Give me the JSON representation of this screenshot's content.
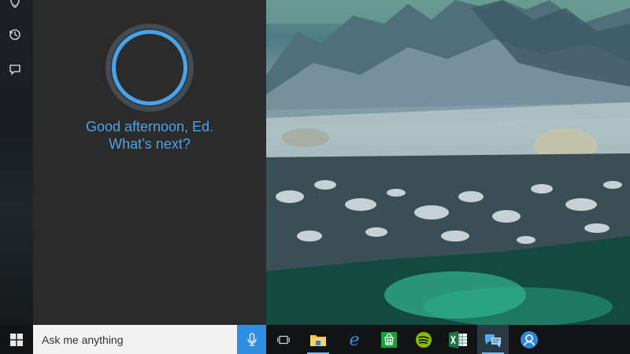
{
  "cortana": {
    "greeting_line1": "Good afternoon, Ed.",
    "greeting_line2": "What’s next?"
  },
  "left_rail": {
    "items": [
      {
        "icon": "lightbulb-icon"
      },
      {
        "icon": "history-icon"
      },
      {
        "icon": "feedback-icon"
      }
    ]
  },
  "taskbar": {
    "start_icon": "windows-logo-icon",
    "search_placeholder": "Ask me anything",
    "mic_icon": "microphone-icon",
    "apps": [
      {
        "name": "task-view",
        "icon": "task-view-icon"
      },
      {
        "name": "file-explorer",
        "icon": "folder-icon"
      },
      {
        "name": "edge",
        "icon": "edge-icon"
      },
      {
        "name": "store",
        "icon": "store-icon"
      },
      {
        "name": "spotify",
        "icon": "spotify-icon"
      },
      {
        "name": "excel",
        "icon": "excel-icon"
      },
      {
        "name": "feedback-app",
        "icon": "speech-bubbles-icon"
      },
      {
        "name": "people",
        "icon": "person-icon"
      }
    ]
  },
  "colors": {
    "accent": "#4aa3e6",
    "panel_bg": "#2b2b2b",
    "taskbar_bg": "#111315",
    "mic_bg": "#2d8ee2"
  }
}
